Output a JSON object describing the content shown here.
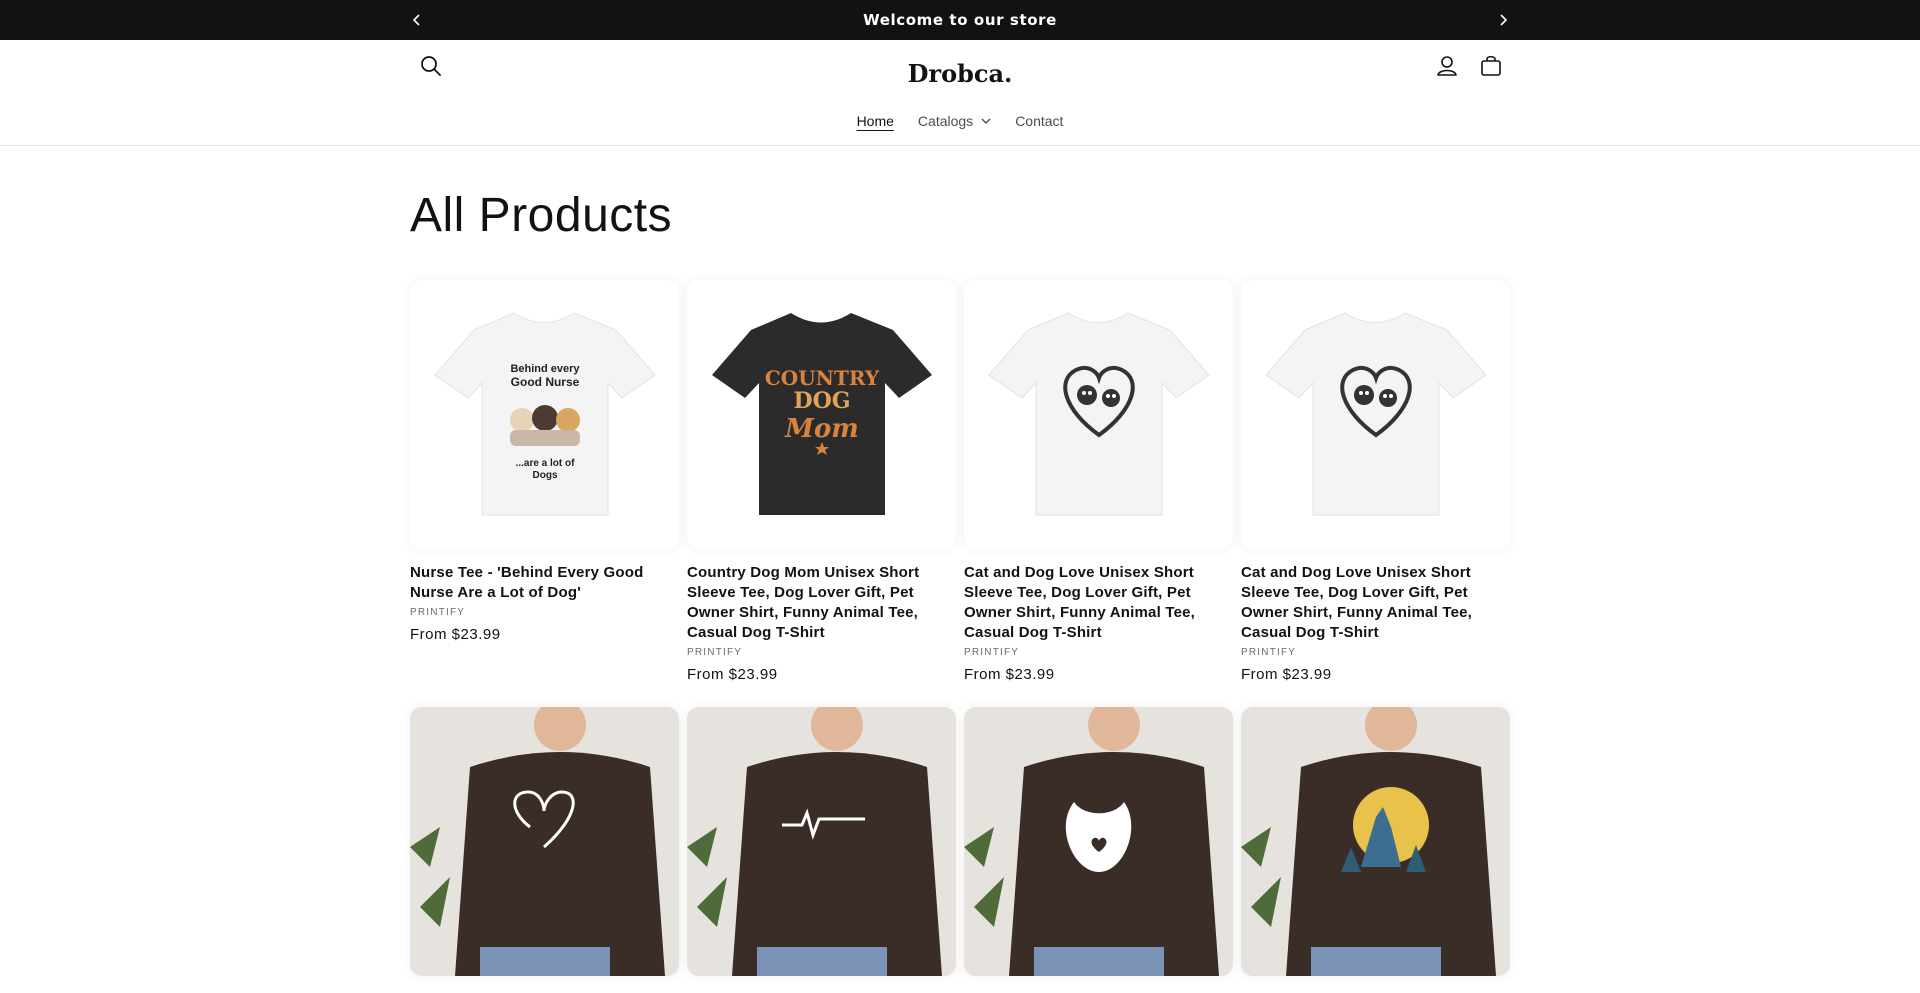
{
  "announcement": {
    "text": "Welcome to our store"
  },
  "header": {
    "logo": "Drobca."
  },
  "nav": {
    "items": [
      {
        "label": "Home"
      },
      {
        "label": "Catalogs"
      },
      {
        "label": "Contact"
      }
    ]
  },
  "page": {
    "title": "All Products"
  },
  "products": [
    {
      "title": "Nurse Tee - 'Behind Every Good Nurse Are a Lot of Dog'",
      "vendor": "PRINTIFY",
      "price": "From $23.99",
      "shirt_color": "#f4f4f4",
      "print_text": [
        "Behind every",
        "Good Nurse",
        "...are a lot of",
        "Dogs"
      ]
    },
    {
      "title": "Country Dog Mom Unisex Short Sleeve Tee, Dog Lover Gift, Pet Owner Shirt, Funny Animal Tee, Casual Dog T-Shirt",
      "vendor": "PRINTIFY",
      "price": "From $23.99",
      "shirt_color": "#2b2b2b",
      "print_text": [
        "COUNTRY",
        "DOG",
        "Mom"
      ]
    },
    {
      "title": "Cat and Dog Love Unisex Short Sleeve Tee, Dog Lover Gift, Pet Owner Shirt, Funny Animal Tee, Casual Dog T-Shirt",
      "vendor": "PRINTIFY",
      "price": "From $23.99",
      "shirt_color": "#f4f4f4"
    },
    {
      "title": "Cat and Dog Love Unisex Short Sleeve Tee, Dog Lover Gift, Pet Owner Shirt, Funny Animal Tee, Casual Dog T-Shirt",
      "vendor": "PRINTIFY",
      "price": "From $23.99",
      "shirt_color": "#f4f4f4"
    },
    {
      "shirt_color": "#3a2c26",
      "design": "paw-heart"
    },
    {
      "shirt_color": "#3a2c26",
      "design": "heartbeat-pets"
    },
    {
      "shirt_color": "#3a2c26",
      "design": "cat-dog-hug"
    },
    {
      "shirt_color": "#3a2c26",
      "design": "howling-wolf-moon"
    }
  ],
  "colors": {
    "announcement_bg": "#121212",
    "text": "#121212",
    "muted": "#6b6b6b",
    "moon": "#e8c24a"
  },
  "icons": [
    "chevron-left-icon",
    "chevron-right-icon",
    "search-icon",
    "account-icon",
    "cart-icon",
    "chevron-down-icon"
  ]
}
